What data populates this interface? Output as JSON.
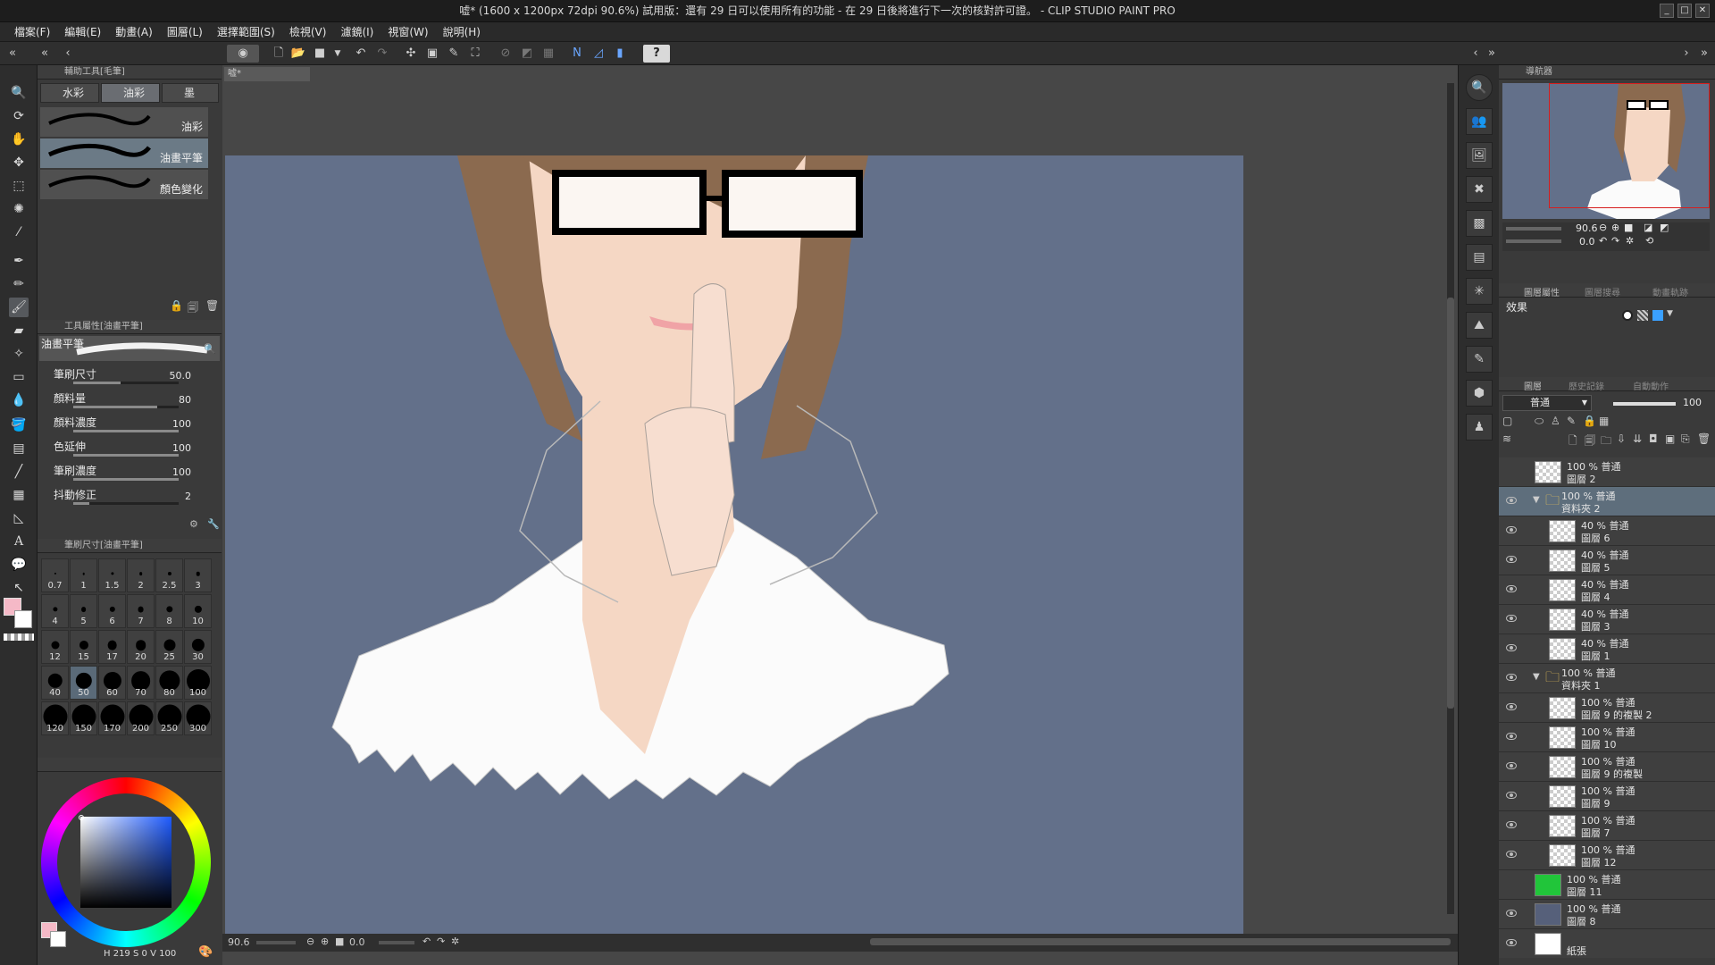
{
  "window": {
    "title": "嘘* (1600 x 1200px 72dpi 90.6%)  試用版：還有 29 日可以使用所有的功能 - 在 29 日後將進行下一次的核對許可證。 - CLIP STUDIO PAINT PRO"
  },
  "menu": [
    "檔案(F)",
    "編輯(E)",
    "動畫(A)",
    "圖層(L)",
    "選擇範圍(S)",
    "檢視(V)",
    "濾鏡(I)",
    "視窗(W)",
    "說明(H)"
  ],
  "subtool": {
    "header": "輔助工具[毛筆]",
    "tabs": [
      "水彩",
      "油彩",
      "墨"
    ],
    "brushes": [
      "油彩",
      "油畫平筆",
      "顏色變化"
    ]
  },
  "toolprop": {
    "header": "工具屬性[油畫平筆]",
    "brush_name": "油畫平筆",
    "props": [
      {
        "label": "筆刷尺寸",
        "value": "50.0",
        "fill": 0.45
      },
      {
        "label": "顏料量",
        "value": "80",
        "fill": 0.8
      },
      {
        "label": "顏料濃度",
        "value": "100",
        "fill": 1.0
      },
      {
        "label": "色延伸",
        "value": "100",
        "fill": 1.0
      },
      {
        "label": "筆刷濃度",
        "value": "100",
        "fill": 1.0
      },
      {
        "label": "抖動修正",
        "value": "2",
        "fill": 0.15
      }
    ]
  },
  "brushsize": {
    "header": "筆刷尺寸[油畫平筆]",
    "sizes": [
      "0.7",
      "1",
      "1.5",
      "2",
      "2.5",
      "3",
      "4",
      "5",
      "6",
      "7",
      "8",
      "10",
      "12",
      "15",
      "17",
      "20",
      "25",
      "30",
      "40",
      "50",
      "60",
      "70",
      "80",
      "100",
      "120",
      "150",
      "170",
      "200",
      "250",
      "300"
    ]
  },
  "color": {
    "readout": {
      "h": "219",
      "s": "0",
      "v": "100"
    },
    "main_color": "#f5b9c7",
    "sub_color": "#ffffff"
  },
  "canvas": {
    "tab_label": "嘘*",
    "zoom": "90.6",
    "angle": "0.0",
    "background": "#63708a"
  },
  "navigator": {
    "zoom": "90.6",
    "angle": "0.0",
    "tabs": [
      "導航器"
    ]
  },
  "layer_property": {
    "tabs": [
      "圖層屬性",
      "圖層搜尋",
      "動畫軌跡"
    ],
    "effect_label": "效果"
  },
  "layer_panel": {
    "tabs": [
      "圖層",
      "歷史記錄",
      "自動動作"
    ],
    "blend_mode": "普通",
    "opacity": "100",
    "layers": [
      {
        "l1": "100 % 普通",
        "l2": "圖層 2",
        "indent": 0,
        "type": "raster",
        "visible": false
      },
      {
        "l1": "100 % 普通",
        "l2": "資料夾 2",
        "indent": 0,
        "type": "folder",
        "visible": true,
        "active": true
      },
      {
        "l1": "40 % 普通",
        "l2": "圖層 6",
        "indent": 1,
        "type": "raster",
        "visible": true
      },
      {
        "l1": "40 % 普通",
        "l2": "圖層 5",
        "indent": 1,
        "type": "raster",
        "visible": true
      },
      {
        "l1": "40 % 普通",
        "l2": "圖層 4",
        "indent": 1,
        "type": "raster",
        "visible": true
      },
      {
        "l1": "40 % 普通",
        "l2": "圖層 3",
        "indent": 1,
        "type": "raster",
        "visible": true
      },
      {
        "l1": "40 % 普通",
        "l2": "圖層 1",
        "indent": 1,
        "type": "raster",
        "visible": true
      },
      {
        "l1": "100 % 普通",
        "l2": "資料夾 1",
        "indent": 0,
        "type": "folder",
        "visible": true
      },
      {
        "l1": "100 % 普通",
        "l2": "圖層 9 的複製 2",
        "indent": 1,
        "type": "raster",
        "visible": true
      },
      {
        "l1": "100 % 普通",
        "l2": "圖層 10",
        "indent": 1,
        "type": "raster",
        "visible": true
      },
      {
        "l1": "100 % 普通",
        "l2": "圖層 9 的複製",
        "indent": 1,
        "type": "raster",
        "visible": true
      },
      {
        "l1": "100 % 普通",
        "l2": "圖層 9",
        "indent": 1,
        "type": "raster",
        "visible": true
      },
      {
        "l1": "100 % 普通",
        "l2": "圖層 7",
        "indent": 1,
        "type": "raster",
        "visible": true
      },
      {
        "l1": "100 % 普通",
        "l2": "圖層 12",
        "indent": 1,
        "type": "raster",
        "visible": true
      },
      {
        "l1": "100 % 普通",
        "l2": "圖層 11",
        "indent": 0,
        "type": "green",
        "visible": false
      },
      {
        "l1": "100 % 普通",
        "l2": "圖層 8",
        "indent": 0,
        "type": "slate",
        "visible": true
      },
      {
        "l1": "",
        "l2": "紙張",
        "indent": 0,
        "type": "paper",
        "visible": true
      }
    ],
    "colors": {
      "green": "#21c53a",
      "slate": "#56607a",
      "paper": "#ffffff",
      "active_row": "#5e6e7c"
    }
  }
}
